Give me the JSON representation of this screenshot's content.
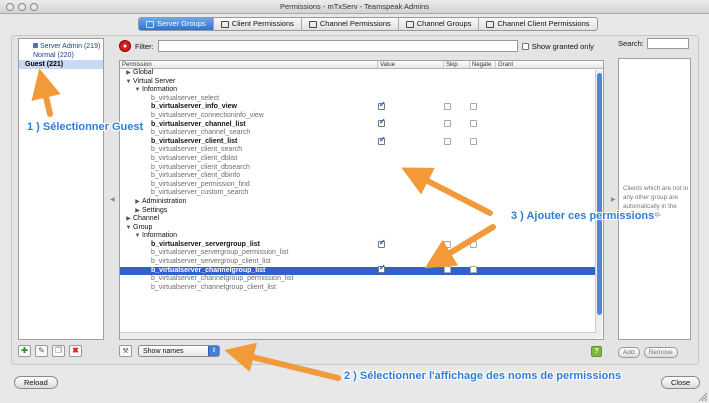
{
  "window": {
    "title": "Permissions - mTxServ - Teamspeak Admins"
  },
  "tabs": [
    {
      "label": "Server Groups",
      "active": true
    },
    {
      "label": "Client Permissions",
      "active": false
    },
    {
      "label": "Channel Permissions",
      "active": false
    },
    {
      "label": "Channel Groups",
      "active": false
    },
    {
      "label": "Channel Client Permissions",
      "active": false
    }
  ],
  "groups": [
    {
      "label": "Server Admin (219)",
      "selected": false
    },
    {
      "label": "Normal (220)",
      "selected": false
    },
    {
      "label": "Guest (221)",
      "selected": true
    }
  ],
  "filter": {
    "label": "Filter:",
    "value": "",
    "show_granted_label": "Show granted only"
  },
  "table": {
    "headers": {
      "permission": "Permission",
      "value": "Value",
      "skip": "Skip",
      "negate": "Negate",
      "grant": "Grant"
    },
    "rows": [
      {
        "label": "Global",
        "level": 0,
        "tri": "▶",
        "style": "node"
      },
      {
        "label": "Virtual Server",
        "level": 0,
        "tri": "▼",
        "style": "node"
      },
      {
        "label": "Information",
        "level": 1,
        "tri": "▼",
        "style": "node"
      },
      {
        "label": "b_virtualserver_select",
        "level": 2,
        "style": "muted"
      },
      {
        "label": "b_virtualserver_info_view",
        "level": 2,
        "style": "set",
        "value": true
      },
      {
        "label": "b_virtualserver_connectioninfo_view",
        "level": 2,
        "style": "muted"
      },
      {
        "label": "b_virtualserver_channel_list",
        "level": 2,
        "style": "set",
        "value": true
      },
      {
        "label": "b_virtualserver_channel_search",
        "level": 2,
        "style": "muted"
      },
      {
        "label": "b_virtualserver_client_list",
        "level": 2,
        "style": "set",
        "value": true
      },
      {
        "label": "b_virtualserver_client_search",
        "level": 2,
        "style": "muted"
      },
      {
        "label": "b_virtualserver_client_dblist",
        "level": 2,
        "style": "muted"
      },
      {
        "label": "b_virtualserver_client_dbsearch",
        "level": 2,
        "style": "muted"
      },
      {
        "label": "b_virtualserver_client_dbinfo",
        "level": 2,
        "style": "muted"
      },
      {
        "label": "b_virtualserver_permission_find",
        "level": 2,
        "style": "muted"
      },
      {
        "label": "b_virtualserver_custom_search",
        "level": 2,
        "style": "muted"
      },
      {
        "label": "Administration",
        "level": 1,
        "tri": "▶",
        "style": "node"
      },
      {
        "label": "Settings",
        "level": 1,
        "tri": "▶",
        "style": "node"
      },
      {
        "label": "Channel",
        "level": 0,
        "tri": "▶",
        "style": "node"
      },
      {
        "label": "Group",
        "level": 0,
        "tri": "▼",
        "style": "node"
      },
      {
        "label": "Information",
        "level": 1,
        "tri": "▼",
        "style": "node"
      },
      {
        "label": "b_virtualserver_servergroup_list",
        "level": 2,
        "style": "set",
        "value": true
      },
      {
        "label": "b_virtualserver_servergroup_permission_list",
        "level": 2,
        "style": "muted"
      },
      {
        "label": "b_virtualserver_servergroup_client_list",
        "level": 2,
        "style": "muted"
      },
      {
        "label": "b_virtualserver_channelgroup_list",
        "level": 2,
        "style": "selected",
        "value": true
      },
      {
        "label": "b_virtualserver_channelgroup_permission_list",
        "level": 2,
        "style": "muted"
      },
      {
        "label": "b_virtualserver_channelgroup_client_list",
        "level": 2,
        "style": "muted"
      }
    ]
  },
  "view_select": {
    "value": "Show names"
  },
  "search": {
    "label": "Search:",
    "value": ""
  },
  "right_note": "Clients which are not in any other group are automatically in the default group.",
  "right_buttons": {
    "add": "Add",
    "remove": "Remove"
  },
  "footer": {
    "reload": "Reload",
    "close": "Close"
  },
  "annotations": {
    "step1": "1 ) Sélectionner Guest",
    "step2": "2 ) Sélectionner l'affichage des noms de permissions",
    "step3": "3 ) Ajouter ces permissions"
  },
  "colors": {
    "arrow": "#f29a3a",
    "annotation_text": "#2f7ddb",
    "selection": "#2f63c9",
    "active_tab": "#3f7fe0"
  }
}
